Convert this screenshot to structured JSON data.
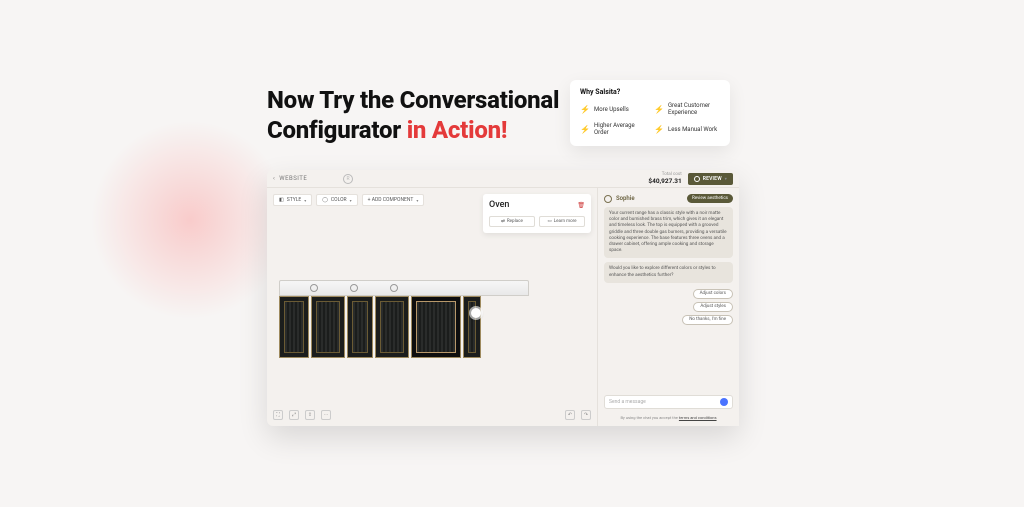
{
  "headline": {
    "line1": "Now Try the Conversational",
    "line2_prefix": "Configurator ",
    "line2_accent": "in Action!"
  },
  "why": {
    "title": "Why Salsita?",
    "items": [
      "More Upsells",
      "Great Customer Experience",
      "Higher Average Order",
      "Less Manual Work"
    ]
  },
  "app": {
    "breadcrumb_icon": "‹",
    "breadcrumb": "WEBSITE",
    "total_label": "Total cost",
    "total_value": "$40,927.31",
    "review_button": "REVIEW",
    "config_bar": {
      "style": "STYLE",
      "color": "COLOR",
      "add": "+  ADD COMPONENT"
    },
    "side_panel": {
      "title": "Oven",
      "replace": "Replace",
      "learn": "Learn more"
    },
    "viewer_tools": {
      "fullscreen": "⛶",
      "measure": "⤢",
      "share": "⇪",
      "more": "⋯",
      "undo": "↶",
      "redo": "↷"
    },
    "chat": {
      "name": "Sophie",
      "user_chip": "Review aesthetics",
      "msg1": "Your current range has a classic style with a noir matte color and burnished brass trim, which gives it an elegant and timeless look. The top is equipped with a grooved griddle and three double gas burners, providing a versatile cooking experience. The base features three ovens and a drawer cabinet, offering ample cooking and storage space.",
      "msg2": "Would you like to explore different colors or styles to enhance the aesthetics further?",
      "suggestions": [
        "Adjust colors",
        "Adjust styles",
        "No thanks, I'm fine"
      ],
      "composer_placeholder": "Send a message",
      "terms_prefix": "By using the chat you accept the ",
      "terms_link": "terms and conditions"
    }
  }
}
